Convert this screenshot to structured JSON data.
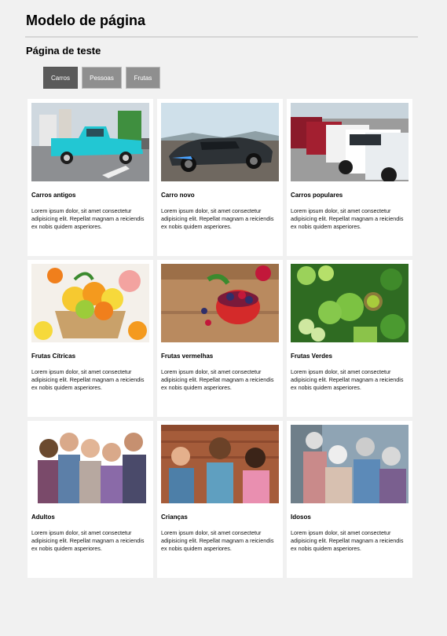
{
  "header": {
    "title": "Modelo de página"
  },
  "section": {
    "title": "Página de teste"
  },
  "tabs": [
    "Carros",
    "Pessoas",
    "Frutas"
  ],
  "cards": [
    {
      "title": "Carros antigos",
      "text": "Lorem ipsum dolor, sit amet consectetur adipisicing elit. Repellat magnam a reiciendis ex nobis quidem asperiores."
    },
    {
      "title": "Carro novo",
      "text": "Lorem ipsum dolor, sit amet consectetur adipisicing elit. Repellat magnam a reiciendis ex nobis quidem asperiores."
    },
    {
      "title": "Carros populares",
      "text": "Lorem ipsum dolor, sit amet consectetur adipisicing elit. Repellat magnam a reiciendis ex nobis quidem asperiores."
    },
    {
      "title": "Frutas Cítricas",
      "text": "Lorem ipsum dolor, sit amet consectetur adipisicing elit. Repellat magnam a reiciendis ex nobis quidem asperiores."
    },
    {
      "title": "Frutas vermelhas",
      "text": "Lorem ipsum dolor, sit amet consectetur adipisicing elit. Repellat magnam a reiciendis ex nobis quidem asperiores."
    },
    {
      "title": "Frutas Verdes",
      "text": "Lorem ipsum dolor, sit amet consectetur adipisicing elit. Repellat magnam a reiciendis ex nobis quidem asperiores."
    },
    {
      "title": "Adultos",
      "text": "Lorem ipsum dolor, sit amet consectetur adipisicing elit. Repellat magnam a reiciendis ex nobis quidem asperiores."
    },
    {
      "title": "Crianças",
      "text": "Lorem ipsum dolor, sit amet consectetur adipisicing elit. Repellat magnam a reiciendis ex nobis quidem asperiores."
    },
    {
      "title": "Idosos",
      "text": "Lorem ipsum dolor, sit amet consectetur adipisicing elit. Repellat magnam a reiciendis ex nobis quidem asperiores."
    }
  ]
}
